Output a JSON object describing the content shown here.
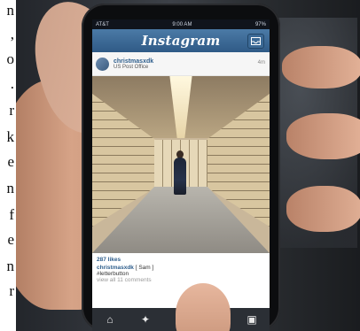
{
  "left_text": [
    "n",
    ",",
    "o",
    ".",
    "r",
    "k",
    "e",
    "n",
    "f",
    "e",
    "n",
    "r"
  ],
  "status_bar": {
    "left": "AT&T",
    "time": "9:00 AM",
    "right": "97%"
  },
  "app": {
    "logo": "Instagram"
  },
  "post": {
    "username": "christmasxdk",
    "location": "US Post Office",
    "time": "4m",
    "likes": "287 likes",
    "comment_user": "christmasxdk",
    "comment_text": "[ Sam ]",
    "comment_text2": "#letterbutton",
    "view_all": "view all 11 comments"
  },
  "tabs": [
    {
      "name": "home-icon",
      "glyph": "⌂"
    },
    {
      "name": "explore-icon",
      "glyph": "✦"
    },
    {
      "name": "camera-icon",
      "glyph": "◉"
    },
    {
      "name": "activity-icon",
      "glyph": "☺"
    },
    {
      "name": "profile-icon",
      "glyph": "▣"
    }
  ],
  "colors": {
    "header_blue": "#3b6a98",
    "tab_bar": "#2b2f35"
  }
}
